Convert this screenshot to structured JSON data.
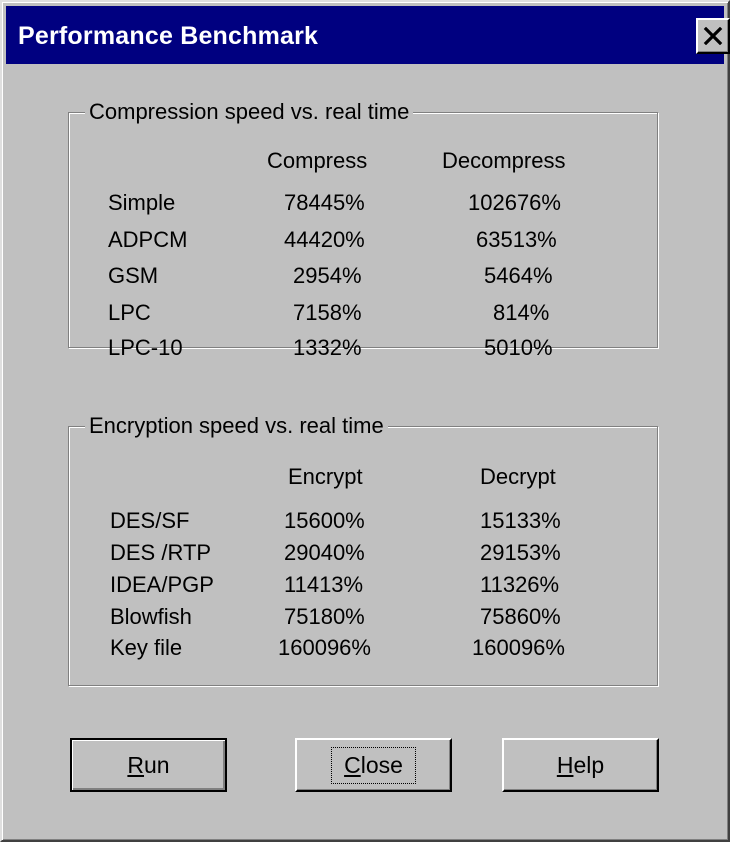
{
  "window": {
    "title": "Performance Benchmark",
    "close_icon": "close-icon"
  },
  "compression": {
    "label": "Compression speed vs. real time",
    "columns": [
      "Compress",
      "Decompress"
    ],
    "rows": [
      {
        "name": "Simple",
        "compress": "78445%",
        "decompress": "102676%"
      },
      {
        "name": "ADPCM",
        "compress": "44420%",
        "decompress": "63513%"
      },
      {
        "name": "GSM",
        "compress": "2954%",
        "decompress": "5464%"
      },
      {
        "name": "LPC",
        "compress": "7158%",
        "decompress": "814%"
      },
      {
        "name": "LPC-10",
        "compress": "1332%",
        "decompress": "5010%"
      }
    ]
  },
  "encryption": {
    "label": "Encryption speed vs. real time",
    "columns": [
      "Encrypt",
      "Decrypt"
    ],
    "rows": [
      {
        "name": "DES/SF",
        "encrypt": "15600%",
        "decrypt": "15133%"
      },
      {
        "name": "DES /RTP",
        "encrypt": "29040%",
        "decrypt": "29153%"
      },
      {
        "name": "IDEA/PGP",
        "encrypt": "11413%",
        "decrypt": "11326%"
      },
      {
        "name": "Blowfish",
        "encrypt": "75180%",
        "decrypt": "75860%"
      },
      {
        "name": "Key file",
        "encrypt": "160096%",
        "decrypt": "160096%"
      }
    ]
  },
  "buttons": {
    "run": {
      "mnemonic": "R",
      "rest": "un"
    },
    "close": {
      "mnemonic": "C",
      "rest": "lose"
    },
    "help": {
      "mnemonic": "H",
      "rest": "elp"
    }
  },
  "colors": {
    "face": "#c0c0c0",
    "titlebar": "#000080",
    "title_text": "#ffffff"
  }
}
